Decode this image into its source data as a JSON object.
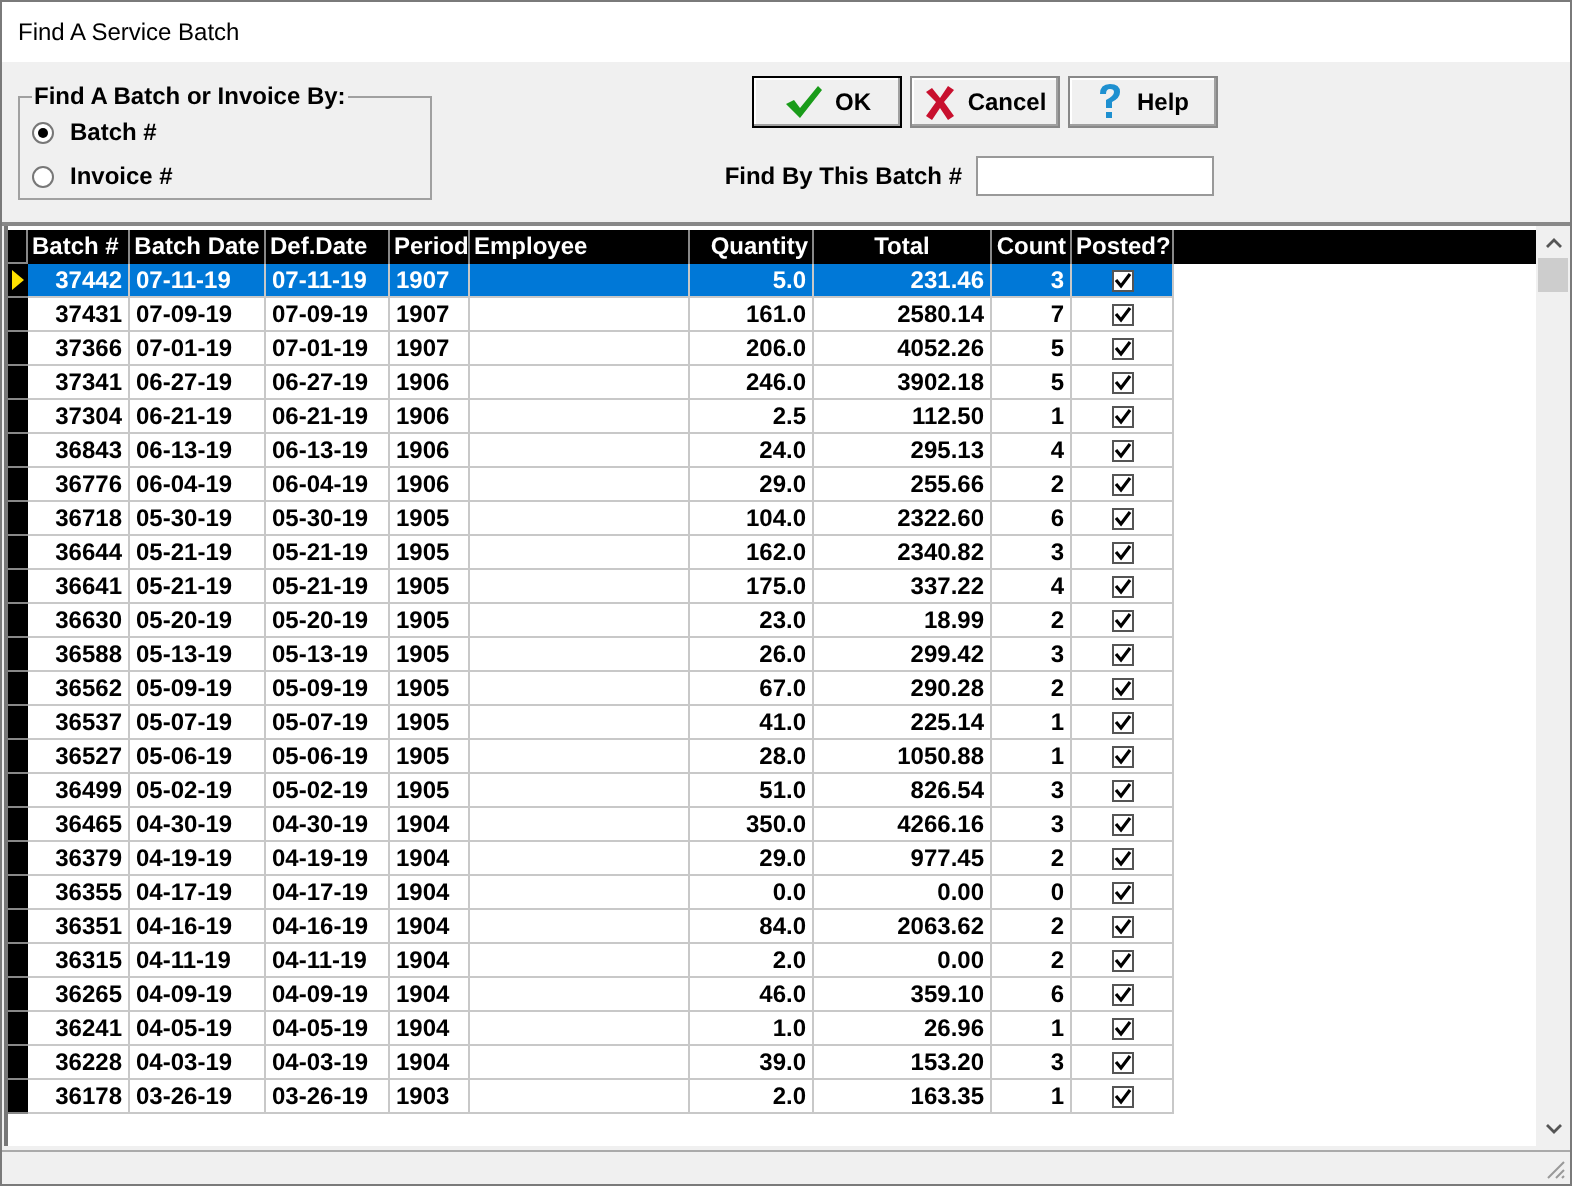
{
  "window": {
    "title": "Find A Service Batch"
  },
  "search_by": {
    "legend": "Find A Batch or Invoice By:",
    "options": [
      {
        "label": "Batch #",
        "selected": true
      },
      {
        "label": "Invoice #",
        "selected": false
      }
    ]
  },
  "buttons": [
    {
      "label": "OK",
      "kind": "ok"
    },
    {
      "label": "Cancel",
      "kind": "cancel"
    },
    {
      "label": "Help",
      "kind": "help"
    }
  ],
  "find_field": {
    "label": "Find By This Batch #"
  },
  "table": {
    "columns": [
      "Batch #",
      "Batch Date",
      "Def.Date",
      "Period",
      "Employee",
      "Quantity",
      "Total",
      "Count",
      "Posted?"
    ],
    "rows": [
      {
        "batch": "37442",
        "batch_date": "07-11-19",
        "def_date": "07-11-19",
        "period": "1907",
        "quantity": "5.0",
        "total": "231.46",
        "count": "3",
        "posted": true,
        "selected": true
      },
      {
        "batch": "37431",
        "batch_date": "07-09-19",
        "def_date": "07-09-19",
        "period": "1907",
        "quantity": "161.0",
        "total": "2580.14",
        "count": "7",
        "posted": true,
        "selected": false
      },
      {
        "batch": "37366",
        "batch_date": "07-01-19",
        "def_date": "07-01-19",
        "period": "1907",
        "quantity": "206.0",
        "total": "4052.26",
        "count": "5",
        "posted": true,
        "selected": false
      },
      {
        "batch": "37341",
        "batch_date": "06-27-19",
        "def_date": "06-27-19",
        "period": "1906",
        "quantity": "246.0",
        "total": "3902.18",
        "count": "5",
        "posted": true,
        "selected": false
      },
      {
        "batch": "37304",
        "batch_date": "06-21-19",
        "def_date": "06-21-19",
        "period": "1906",
        "quantity": "2.5",
        "total": "112.50",
        "count": "1",
        "posted": true,
        "selected": false
      },
      {
        "batch": "36843",
        "batch_date": "06-13-19",
        "def_date": "06-13-19",
        "period": "1906",
        "quantity": "24.0",
        "total": "295.13",
        "count": "4",
        "posted": true,
        "selected": false
      },
      {
        "batch": "36776",
        "batch_date": "06-04-19",
        "def_date": "06-04-19",
        "period": "1906",
        "quantity": "29.0",
        "total": "255.66",
        "count": "2",
        "posted": true,
        "selected": false
      },
      {
        "batch": "36718",
        "batch_date": "05-30-19",
        "def_date": "05-30-19",
        "period": "1905",
        "quantity": "104.0",
        "total": "2322.60",
        "count": "6",
        "posted": true,
        "selected": false
      },
      {
        "batch": "36644",
        "batch_date": "05-21-19",
        "def_date": "05-21-19",
        "period": "1905",
        "quantity": "162.0",
        "total": "2340.82",
        "count": "3",
        "posted": true,
        "selected": false
      },
      {
        "batch": "36641",
        "batch_date": "05-21-19",
        "def_date": "05-21-19",
        "period": "1905",
        "quantity": "175.0",
        "total": "337.22",
        "count": "4",
        "posted": true,
        "selected": false
      },
      {
        "batch": "36630",
        "batch_date": "05-20-19",
        "def_date": "05-20-19",
        "period": "1905",
        "quantity": "23.0",
        "total": "18.99",
        "count": "2",
        "posted": true,
        "selected": false
      },
      {
        "batch": "36588",
        "batch_date": "05-13-19",
        "def_date": "05-13-19",
        "period": "1905",
        "quantity": "26.0",
        "total": "299.42",
        "count": "3",
        "posted": true,
        "selected": false
      },
      {
        "batch": "36562",
        "batch_date": "05-09-19",
        "def_date": "05-09-19",
        "period": "1905",
        "quantity": "67.0",
        "total": "290.28",
        "count": "2",
        "posted": true,
        "selected": false
      },
      {
        "batch": "36537",
        "batch_date": "05-07-19",
        "def_date": "05-07-19",
        "period": "1905",
        "quantity": "41.0",
        "total": "225.14",
        "count": "1",
        "posted": true,
        "selected": false
      },
      {
        "batch": "36527",
        "batch_date": "05-06-19",
        "def_date": "05-06-19",
        "period": "1905",
        "quantity": "28.0",
        "total": "1050.88",
        "count": "1",
        "posted": true,
        "selected": false
      },
      {
        "batch": "36499",
        "batch_date": "05-02-19",
        "def_date": "05-02-19",
        "period": "1905",
        "quantity": "51.0",
        "total": "826.54",
        "count": "3",
        "posted": true,
        "selected": false
      },
      {
        "batch": "36465",
        "batch_date": "04-30-19",
        "def_date": "04-30-19",
        "period": "1904",
        "quantity": "350.0",
        "total": "4266.16",
        "count": "3",
        "posted": true,
        "selected": false
      },
      {
        "batch": "36379",
        "batch_date": "04-19-19",
        "def_date": "04-19-19",
        "period": "1904",
        "quantity": "29.0",
        "total": "977.45",
        "count": "2",
        "posted": true,
        "selected": false
      },
      {
        "batch": "36355",
        "batch_date": "04-17-19",
        "def_date": "04-17-19",
        "period": "1904",
        "quantity": "0.0",
        "total": "0.00",
        "count": "0",
        "posted": true,
        "selected": false
      },
      {
        "batch": "36351",
        "batch_date": "04-16-19",
        "def_date": "04-16-19",
        "period": "1904",
        "quantity": "84.0",
        "total": "2063.62",
        "count": "2",
        "posted": true,
        "selected": false
      },
      {
        "batch": "36315",
        "batch_date": "04-11-19",
        "def_date": "04-11-19",
        "period": "1904",
        "quantity": "2.0",
        "total": "0.00",
        "count": "2",
        "posted": true,
        "selected": false
      },
      {
        "batch": "36265",
        "batch_date": "04-09-19",
        "def_date": "04-09-19",
        "period": "1904",
        "quantity": "46.0",
        "total": "359.10",
        "count": "6",
        "posted": true,
        "selected": false
      },
      {
        "batch": "36241",
        "batch_date": "04-05-19",
        "def_date": "04-05-19",
        "period": "1904",
        "quantity": "1.0",
        "total": "26.96",
        "count": "1",
        "posted": true,
        "selected": false
      },
      {
        "batch": "36228",
        "batch_date": "04-03-19",
        "def_date": "04-03-19",
        "period": "1904",
        "quantity": "39.0",
        "total": "153.20",
        "count": "3",
        "posted": true,
        "selected": false
      },
      {
        "batch": "36178",
        "batch_date": "03-26-19",
        "def_date": "03-26-19",
        "period": "1903",
        "quantity": "2.0",
        "total": "163.35",
        "count": "1",
        "posted": true,
        "selected": false
      }
    ]
  }
}
